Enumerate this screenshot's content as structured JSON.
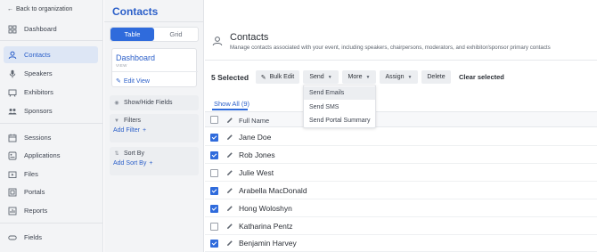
{
  "sidebar": {
    "back_label": "Back to organization",
    "items": [
      {
        "label": "Dashboard",
        "icon": "grid-icon"
      },
      {
        "label": "Contacts",
        "icon": "person-icon",
        "active": true
      },
      {
        "label": "Speakers",
        "icon": "microphone-icon"
      },
      {
        "label": "Exhibitors",
        "icon": "exhibitor-icon"
      },
      {
        "label": "Sponsors",
        "icon": "people-icon"
      },
      {
        "label": "Sessions",
        "icon": "calendar-icon"
      },
      {
        "label": "Applications",
        "icon": "application-icon"
      },
      {
        "label": "Files",
        "icon": "file-icon"
      },
      {
        "label": "Portals",
        "icon": "portal-icon"
      },
      {
        "label": "Reports",
        "icon": "report-icon"
      },
      {
        "label": "Fields",
        "icon": "field-icon"
      }
    ]
  },
  "views_panel": {
    "title": "Contacts",
    "toggle": {
      "table": "Table",
      "grid": "Grid"
    },
    "current_view": {
      "name": "Dashboard",
      "sub": "VIEW",
      "edit_label": "Edit View"
    },
    "show_hide_label": "Show/Hide Fields",
    "filters_label": "Filters",
    "add_filter_label": "Add Filter",
    "sort_label": "Sort By",
    "add_sort_label": "Add Sort By"
  },
  "main": {
    "title": "Contacts",
    "subtitle": "Manage contacts associated with your event, including speakers, chairpersons, moderators, and exhibitor/sponsor primary contacts",
    "selected_count": "5 Selected",
    "toolbar": {
      "bulk_edit": "Bulk Edit",
      "send": "Send",
      "more": "More",
      "assign": "Assign",
      "delete": "Delete",
      "clear_selected": "Clear selected"
    },
    "send_menu": [
      "Send Emails",
      "Send SMS",
      "Send Portal Summary"
    ],
    "tab_label": "Show All (9)",
    "column_header": "Full Name",
    "rows": [
      {
        "name": "Jane Doe",
        "checked": true
      },
      {
        "name": "Rob Jones",
        "checked": true
      },
      {
        "name": "Julie West",
        "checked": false
      },
      {
        "name": "Arabella MacDonald",
        "checked": true
      },
      {
        "name": "Hong Woloshyn",
        "checked": true
      },
      {
        "name": "Katharina Pentz",
        "checked": false
      },
      {
        "name": "Benjamin Harvey",
        "checked": true
      }
    ]
  },
  "colors": {
    "accent": "#2f6bdc",
    "sidebar_bg": "#f3f4f6",
    "active_bg": "#dde6f5"
  }
}
